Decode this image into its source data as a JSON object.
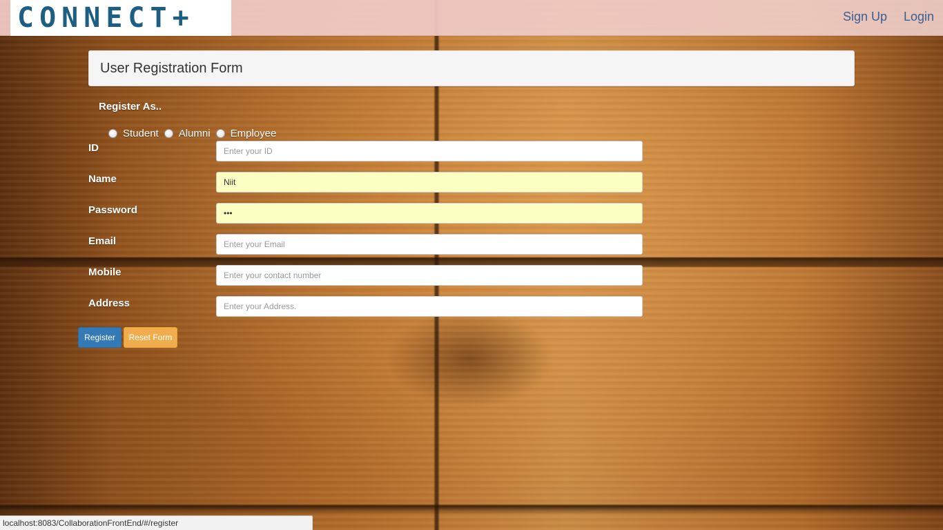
{
  "header": {
    "logo_text": "CONNECT+",
    "nav": {
      "signup_label": "Sign Up",
      "login_label": "Login"
    }
  },
  "form": {
    "title": "User Registration Form",
    "register_as_label": "Register As..",
    "roles": [
      "Student",
      "Alumni",
      "Employee"
    ],
    "fields": {
      "id": {
        "label": "ID",
        "value": "",
        "placeholder": "Enter your ID"
      },
      "name": {
        "label": "Name",
        "value": "Niit",
        "placeholder": ""
      },
      "password": {
        "label": "Password",
        "value": "•••",
        "placeholder": ""
      },
      "email": {
        "label": "Email",
        "value": "",
        "placeholder": "Enter your Email"
      },
      "mobile": {
        "label": "Mobile",
        "value": "",
        "placeholder": "Enter your contact number"
      },
      "address": {
        "label": "Address",
        "value": "",
        "placeholder": "Enter your Address."
      }
    },
    "buttons": {
      "register_label": "Register",
      "reset_label": "Reset Form"
    }
  },
  "status_bar": {
    "url": "localhost:8083/CollaborationFrontEnd/#/register"
  },
  "colors": {
    "logo": "#1c5f82",
    "nav_link": "#3b5f8e",
    "register_button": "#337ab7",
    "reset_button": "#f0ad4e",
    "autofill_field": "#fbffc1"
  }
}
